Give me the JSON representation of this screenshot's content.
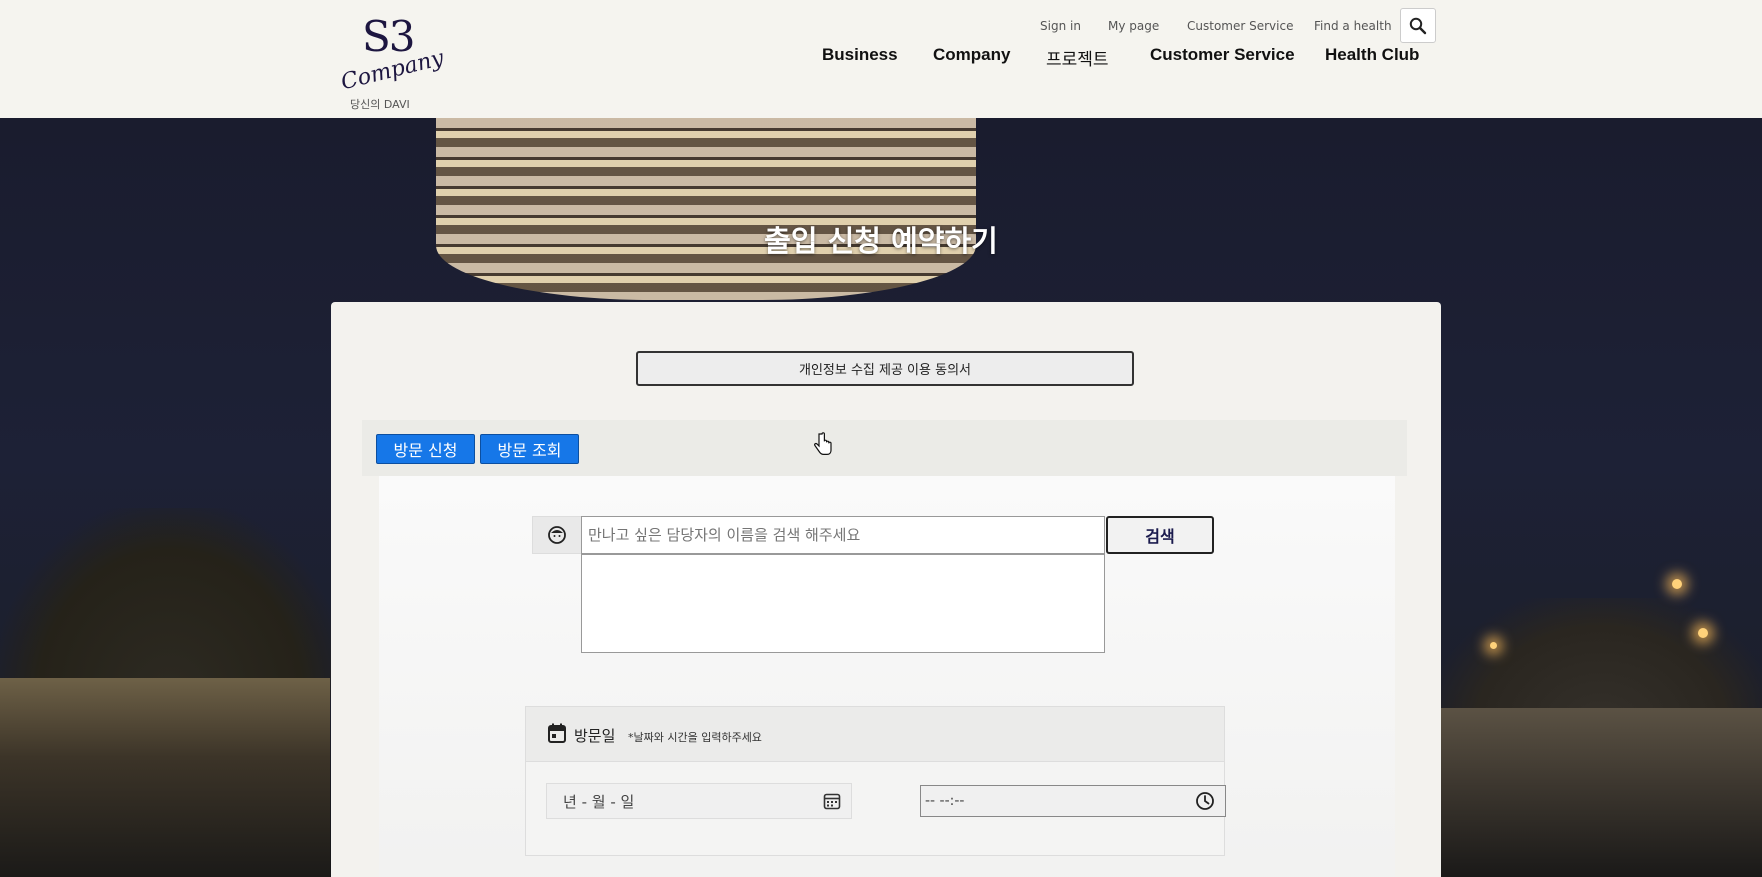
{
  "header": {
    "logo_text": "S3",
    "logo_script": "Company",
    "logo_sub": "당신의 DAVI",
    "util_links": [
      "Sign in",
      "My page",
      "Customer Service",
      "Find a health"
    ],
    "nav": [
      "Business",
      "Company",
      "프로젝트",
      "Customer Service",
      "Health Club"
    ]
  },
  "hero": {
    "title": "출입 신청 예약하기"
  },
  "panel": {
    "consent_button": "개인정보 수집 제공 이용 동의서",
    "tabs": [
      "방문 신청",
      "방문 조회"
    ],
    "search": {
      "placeholder": "만나고 싶은 담당자의 이름을 검색 해주세요",
      "button": "검색"
    },
    "visit_date": {
      "label": "방문일",
      "hint": "*날짜와 시간을 입력하주세요",
      "date_placeholder": "년 - 월 - 일",
      "time_placeholder": "-- --:--"
    }
  }
}
